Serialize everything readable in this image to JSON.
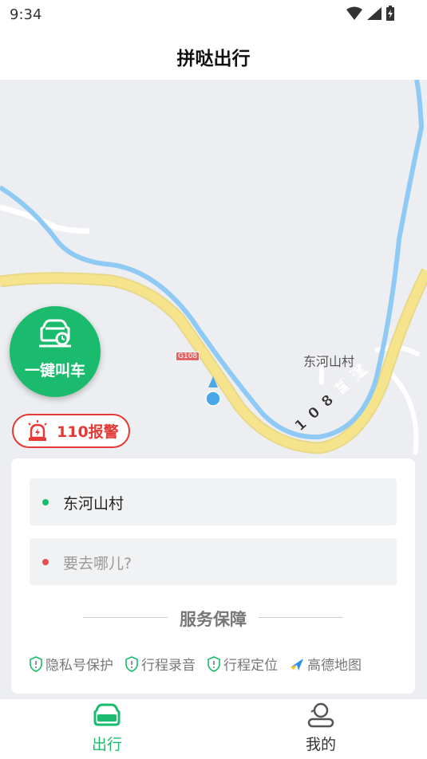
{
  "status": {
    "time": "9:34"
  },
  "header": {
    "title": "拼哒出行"
  },
  "map": {
    "place_label": "东河山村",
    "road_shield": "G108",
    "road_name": "108国道"
  },
  "call_button": {
    "label": "一键叫车"
  },
  "alarm_button": {
    "label": "110报警"
  },
  "trip_card": {
    "origin": "东河山村",
    "destination_placeholder": "要去哪儿?",
    "service_title": "服务保障",
    "services": [
      {
        "label": "隐私号保护",
        "icon": "shield-icon"
      },
      {
        "label": "行程录音",
        "icon": "shield-icon"
      },
      {
        "label": "行程定位",
        "icon": "shield-icon"
      },
      {
        "label": "高德地图",
        "icon": "amap-logo-icon"
      }
    ]
  },
  "bottom_nav": {
    "items": [
      {
        "label": "出行",
        "icon": "car-icon",
        "active": true
      },
      {
        "label": "我的",
        "icon": "user-icon",
        "active": false
      }
    ]
  },
  "colors": {
    "brand": "#1bbb6e",
    "alarm": "#e53935",
    "road": "#f5e48b",
    "river": "#8fcaf5"
  }
}
